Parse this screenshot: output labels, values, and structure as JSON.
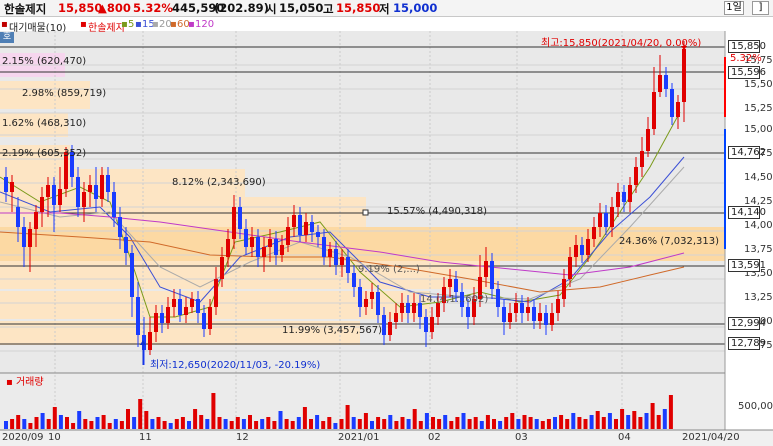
{
  "header": {
    "stock_name": "한솔제지",
    "price": "15,850",
    "change": "▲800",
    "change_pct": "5.32%",
    "volume": "445,590",
    "volume_pct": "(202.89)",
    "open_label": "시",
    "open": "15,050",
    "high_label": "고",
    "high": "15,850",
    "low_label": "저",
    "low": "15,000",
    "period_button": "1일",
    "close_button": "]"
  },
  "legend": {
    "bar_profile": "대기매물(10)",
    "stock_label": "한솔제지",
    "ma5": "5",
    "ma15": "15",
    "ma20": "20",
    "ma60": "60",
    "ma120": "120",
    "colors": {
      "ma5": "#7a9a1a",
      "ma15": "#3c50d6",
      "ma20": "#aaaaaa",
      "ma60": "#d06a2a",
      "ma120": "#c03ac8"
    }
  },
  "ho_button": "호",
  "profile_labels": [
    "2.15% (620,470)",
    "2.98% (859,719)",
    "1.62% (468,310)",
    "2.19% (605,352)",
    "8.12% (2,343,690)",
    "15.57% (4,490,318)",
    "24.36% (7,032,313)",
    "11.99% (3,457,567)"
  ],
  "obscured_profile_labels": [
    "9.19% (2,...)",
    "14.(4,1...602)"
  ],
  "annotations": {
    "high": "최고:15,850(2021/04/20, 0.00%)",
    "low": "최저:12,650(2020/11/03, -20.19%)"
  },
  "price_axis": {
    "ticks": [
      "15,750",
      "15,500",
      "15,250",
      "15,000",
      "14,750",
      "14,500",
      "14,250",
      "14,000",
      "13,750",
      "13,500",
      "13,250",
      "13,000",
      "12,750"
    ],
    "levels": [
      "15,850",
      "15,596",
      "14,762",
      "14,140",
      "13,591",
      "12,994",
      "12,789"
    ],
    "current_tag": "5.32%"
  },
  "volume_panel": {
    "name": "거래량",
    "tick": "500,000"
  },
  "date_axis": [
    "2020/09",
    "10",
    "11",
    "12",
    "2021/01",
    "02",
    "03",
    "04",
    "2021/04/20"
  ]
}
